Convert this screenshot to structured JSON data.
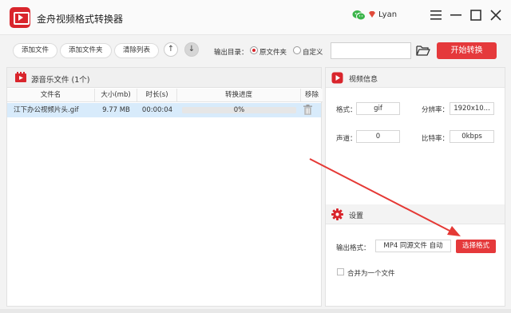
{
  "app": {
    "title": "金舟视频格式转换器",
    "user_name": "Lyan"
  },
  "toolbar": {
    "add_file": "添加文件",
    "add_folder": "添加文件夹",
    "clear_list": "清除列表",
    "move_up": "↑",
    "move_down": "↓",
    "output_dir_label": "输出目录：",
    "option_source_folder": "原文件夹",
    "option_custom": "自定义",
    "output_path_value": "",
    "start_convert": "开始转换"
  },
  "file_list": {
    "title": "源音乐文件 (1个)",
    "columns": [
      "文件名",
      "大小(mb)",
      "时长(s)",
      "转换进度",
      "移除"
    ],
    "rows": [
      {
        "name": "江下办公视频片头.gif",
        "size": "9.77 MB",
        "duration": "00:00:04",
        "progress_text": "0%",
        "progress": 0
      }
    ]
  },
  "video_info": {
    "title": "视频信息",
    "format_label": "格式：",
    "format_value": "gif",
    "resolution_label": "分辨率：",
    "resolution_value": "1920x10...",
    "channel_label": "声道：",
    "channel_value": "0",
    "bitrate_label": "比特率：",
    "bitrate_value": "0kbps"
  },
  "settings": {
    "title": "设置",
    "output_format_label": "输出格式：",
    "output_format_value": "MP4 同源文件 自动",
    "choose_format": "选择格式",
    "merge_label": "合并为一个文件",
    "merge_checked": false
  },
  "colors": {
    "accent": "#e5393b",
    "selected_row": "#d8ebfb"
  }
}
